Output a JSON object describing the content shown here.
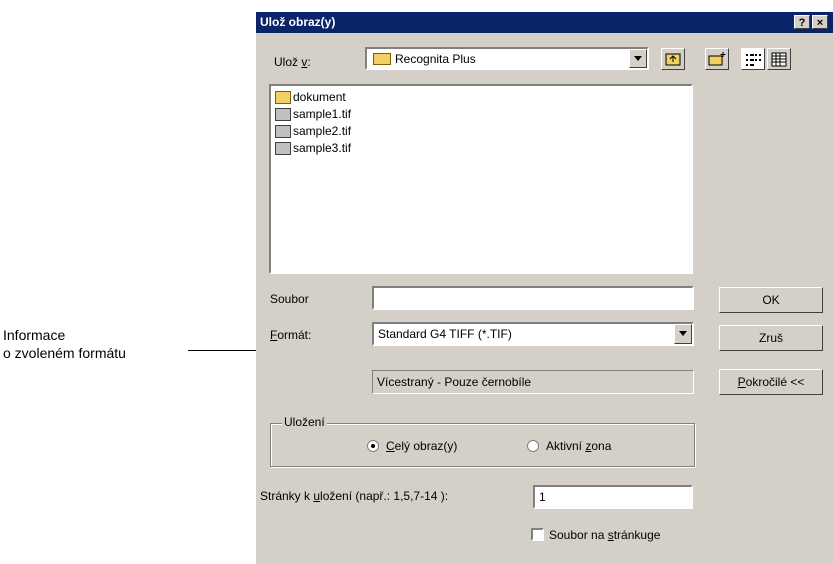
{
  "annotation": {
    "line1": "Informace",
    "line2": "o zvoleném formátu"
  },
  "dialog": {
    "title": "Ulož obraz(y)",
    "help_btn": "?",
    "close_btn": "×",
    "save_in_label": "Ulož v:",
    "save_in_value": "Recognita Plus",
    "files": [
      {
        "name": "dokument",
        "icon": "folder-icon"
      },
      {
        "name": "sample1.tif",
        "icon": "image-file-icon"
      },
      {
        "name": "sample2.tif",
        "icon": "image-file-icon"
      },
      {
        "name": "sample3.tif",
        "icon": "image-file-icon"
      }
    ],
    "file_label": "Soubor",
    "file_value": "",
    "format_label": "Formát:",
    "format_value": "Standard G4 TIFF (*.TIF)",
    "format_info": "Vícestraný  -  Pouze černobíle",
    "ok_button": "OK",
    "cancel_button": "Zruš",
    "advanced_button": "Pokročilé <<",
    "save_group_label": "Uložení",
    "radio_whole": "Celý obraz(y)",
    "radio_zone": "Aktivní zona",
    "radio_selected": "whole",
    "pages_label": "Stránky k uložení (např.: 1,5,7-14 ):",
    "pages_value": "1",
    "checkbox_label": "Soubor na stránkuge",
    "checkbox_checked": false
  }
}
